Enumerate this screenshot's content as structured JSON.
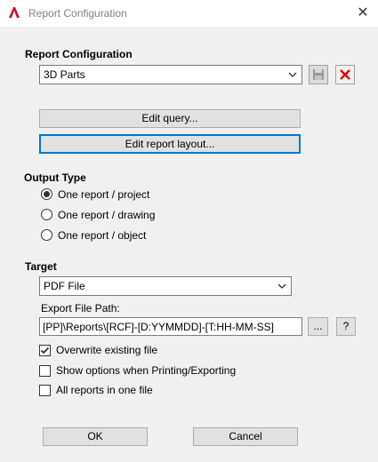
{
  "window": {
    "title": "Report Configuration",
    "close_icon": "close-icon",
    "app_icon": "autocad-a-icon"
  },
  "config": {
    "heading": "Report Configuration",
    "selected": "3D Parts",
    "save_icon": "save-icon",
    "delete_icon": "delete-icon",
    "delete_color": "#e00000"
  },
  "buttons": {
    "edit_query": "Edit query...",
    "edit_layout": "Edit report layout...",
    "ok": "OK",
    "cancel": "Cancel"
  },
  "output_type": {
    "heading": "Output Type",
    "options": [
      "One report / project",
      "One report / drawing",
      "One report / object"
    ],
    "selected_index": 0
  },
  "target": {
    "heading": "Target",
    "selected": "PDF File",
    "export_label": "Export File Path:",
    "export_path": "[PP]\\Reports\\[RCF]-[D:YYMMDD]-[T:HH-MM-SS]",
    "browse_label": "...",
    "help_label": "?"
  },
  "options": [
    {
      "label": "Overwrite existing file",
      "checked": true
    },
    {
      "label": "Show options when Printing/Exporting",
      "checked": false
    },
    {
      "label": "All reports in one file",
      "checked": false
    }
  ],
  "colors": {
    "focus_border": "#0078d7",
    "accent_red": "#c8102e"
  }
}
